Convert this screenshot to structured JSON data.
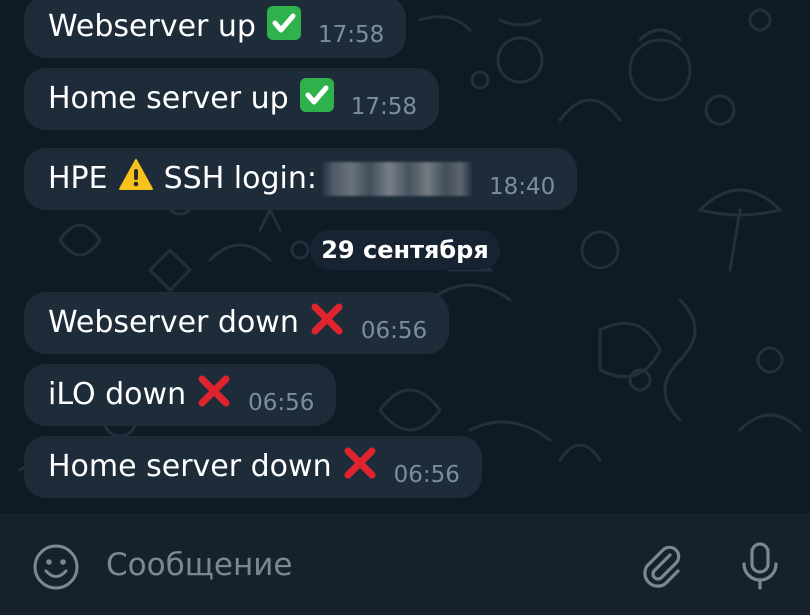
{
  "messages": [
    {
      "text": "Webserver up",
      "status": "check",
      "time": "17:58"
    },
    {
      "text": "Home server up",
      "status": "check",
      "time": "17:58"
    },
    {
      "text": "HPE",
      "warning": true,
      "text2": "SSH login:",
      "redacted": true,
      "time": "18:40"
    },
    {
      "text": "Webserver down",
      "status": "cross",
      "time": "06:56"
    },
    {
      "text": "iLO down",
      "status": "cross",
      "time": "06:56"
    },
    {
      "text": "Home server down",
      "status": "cross",
      "time": "06:56"
    }
  ],
  "date_separator": "29 сентября",
  "composer": {
    "placeholder": "Сообщение",
    "icons": [
      "smiley-icon",
      "paperclip-icon",
      "microphone-icon"
    ]
  },
  "colors": {
    "background": "#0e1621",
    "bubble": "#1e2c3a",
    "time_text": "#7b8d9e",
    "check_green": "#2fb24c",
    "cross_red": "#e0242e",
    "warning_yellow": "#f7c21a"
  }
}
